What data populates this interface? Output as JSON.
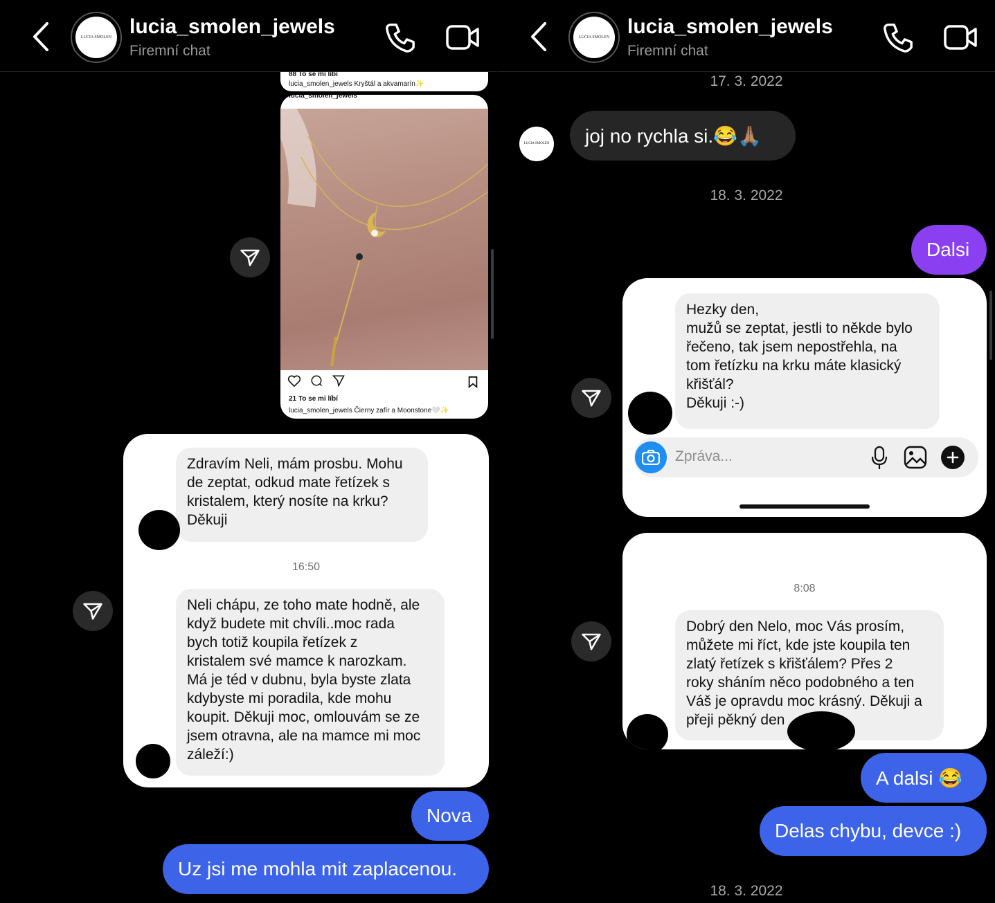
{
  "left": {
    "header": {
      "name": "lucia_smolen_jewels",
      "subtitle": "Firemní chat",
      "logo_text": "LUCIA SMOLEN"
    },
    "post": {
      "top_likes": "88 To se mi líbí",
      "top_caption": "lucia_smolen_jewels Kryštál a akvamarín✨",
      "inner_user": "lucia_smolen_jewels",
      "likes": "21 To se mi líbí",
      "caption": "lucia_smolen_jewels Čierny zafír a Moonstone🤍✨"
    },
    "card_messages": [
      "Zdravím Neli, mám prosbu. Mohu\nde zeptat, odkud mate řetízek s\nkristalem, který nosíte na krku?\nDěkuji",
      "Neli chápu, ze toho mate hodně, ale\nkdyž budete mit chvíli..moc rada\nbych totiž koupila řetízek z\nkristalem své mamce k narozkam.\nMá je téd v dubnu, byla byste zlata\nkdybyste mi poradila, kde mohu\nkoupit. Děkuji moc, omlouvám se ze\njsem otravna, ale na mamce mi moc\nzáleží:)"
    ],
    "card_time": "16:50",
    "outgoing": [
      "Nova",
      "Uz jsi me mohla mit zaplacenou."
    ]
  },
  "right": {
    "header": {
      "name": "lucia_smolen_jewels",
      "subtitle": "Firemní chat",
      "logo_text": "LUCIA SMOLEN"
    },
    "date1": "17. 3. 2022",
    "incoming": "joj no rychla si.😂🙏🏽",
    "date2": "18. 3. 2022",
    "out1": "Dalsi",
    "card1_message": "Hezky den,\nmužů se zeptat, jestli to někde bylo\nřečeno, tak jsem nepostřehla, na\ntom řetízku na krku máte klasický\nkřišťál?\nDěkuji :-)",
    "card1_placeholder": "Zpráva...",
    "card2_time": "8:08",
    "card2_message": "Dobrý den Nelo, moc Vás prosím,\nmůžete mi říct, kde jste koupila ten\nzlatý řetízek s křišťálem? Přes 2\nroky sháním něco podobného a ten\nVáš je opravdu moc krásný. Děkuji a\npřeji pěkný den",
    "out2": "A dalsi 😂",
    "out3": "Delas chybu, devce :)",
    "date3": "18. 3. 2022"
  },
  "colors": {
    "blue": "#3d63e8",
    "purple": "#8a3ff0",
    "incoming": "#262626",
    "camera": "#1f8ef1"
  },
  "icons": [
    "back-chevron-icon",
    "phone-icon",
    "video-icon",
    "paper-plane-icon",
    "camera-icon",
    "microphone-icon",
    "gallery-icon",
    "plus-icon",
    "heart-icon",
    "comment-icon",
    "bookmark-icon"
  ]
}
